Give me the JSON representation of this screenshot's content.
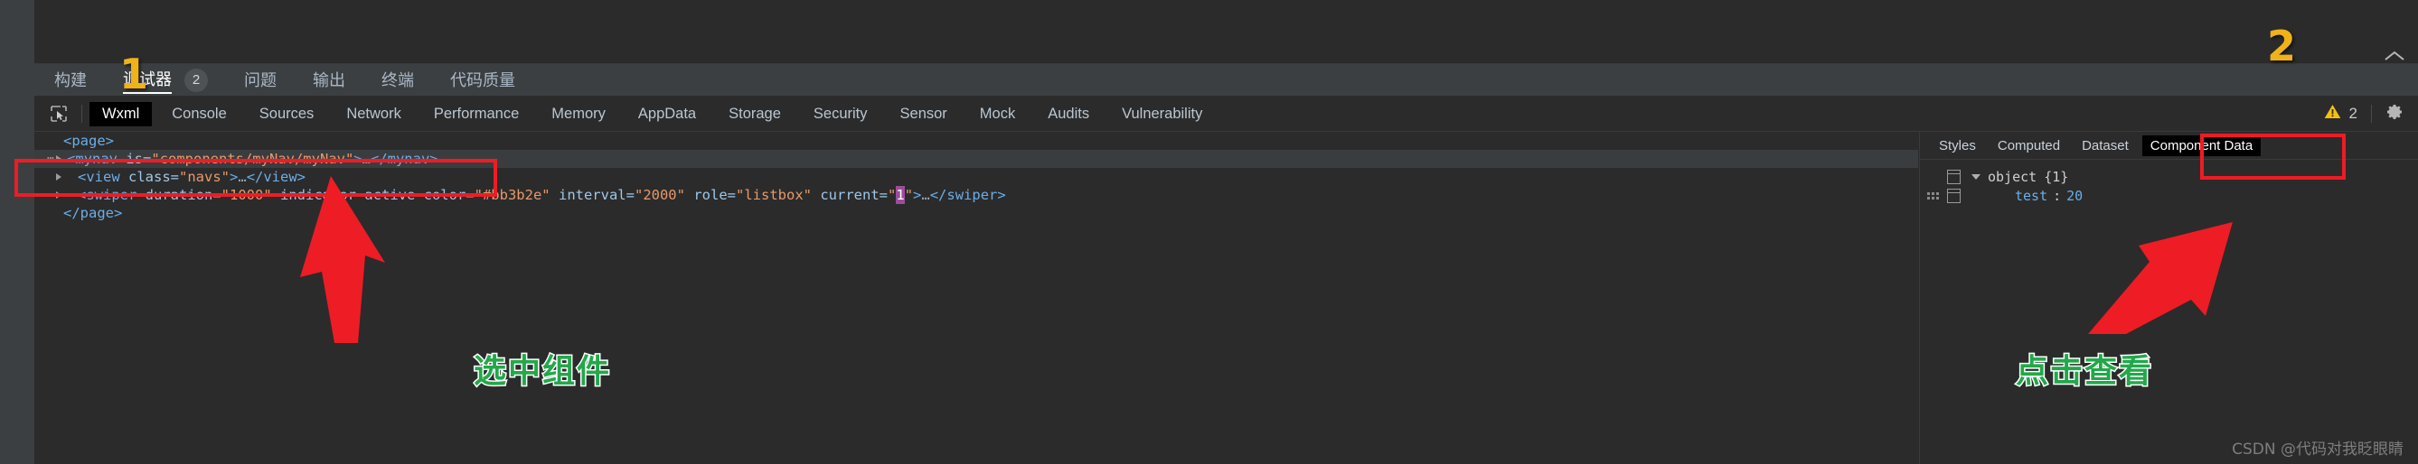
{
  "outer_tabs": [
    {
      "label": "构建",
      "active": false,
      "badge": null
    },
    {
      "label": "调试器",
      "active": true,
      "badge": "2"
    },
    {
      "label": "问题",
      "active": false,
      "badge": null
    },
    {
      "label": "输出",
      "active": false,
      "badge": null
    },
    {
      "label": "终端",
      "active": false,
      "badge": null
    },
    {
      "label": "代码质量",
      "active": false,
      "badge": null
    }
  ],
  "devtools_tabs": [
    {
      "label": "Wxml",
      "active": true
    },
    {
      "label": "Console",
      "active": false
    },
    {
      "label": "Sources",
      "active": false
    },
    {
      "label": "Network",
      "active": false
    },
    {
      "label": "Performance",
      "active": false
    },
    {
      "label": "Memory",
      "active": false
    },
    {
      "label": "AppData",
      "active": false
    },
    {
      "label": "Storage",
      "active": false
    },
    {
      "label": "Security",
      "active": false
    },
    {
      "label": "Sensor",
      "active": false
    },
    {
      "label": "Mock",
      "active": false
    },
    {
      "label": "Audits",
      "active": false
    },
    {
      "label": "Vulnerability",
      "active": false
    }
  ],
  "toolbar": {
    "inspect_icon": "inspect-element-icon",
    "warning_icon": "warning-triangle-icon",
    "warning_count": "2",
    "settings_icon": "gear-icon",
    "collapse_icon": "chevron-up-icon"
  },
  "code": {
    "line_page_open": "<page>",
    "line_mynav": {
      "dots": "⋯",
      "tag_open": "<mynav ",
      "attr": "is=",
      "value": "\"components/myNav/myNav\"",
      "gt": ">",
      "ellipsis": "…",
      "tag_close": "</mynav>"
    },
    "line_view": {
      "tag_open": "<view ",
      "attr": "class=",
      "value": "\"navs\"",
      "gt": ">",
      "ellipsis": "…",
      "tag_close": "</view>"
    },
    "line_swiper": {
      "tag_open": "<swiper ",
      "attr1": "duration=",
      "value1": "\"1000\"",
      "attr2": "indicator-active-color=",
      "value2": "\"#bb3b2e\"",
      "attr3": "interval=",
      "value3": "\"2000\"",
      "attr4": "role=",
      "value4": "\"listbox\"",
      "attr5": "current=",
      "value5_quote_open": "\"",
      "value5_highlight": "1",
      "value5_quote_close": "\"",
      "gt": ">",
      "ellipsis": "…",
      "tag_close": "</swiper>"
    },
    "line_page_close": "</page>"
  },
  "right_panel": {
    "tabs": [
      {
        "label": "Styles",
        "active": false
      },
      {
        "label": "Computed",
        "active": false
      },
      {
        "label": "Dataset",
        "active": false
      },
      {
        "label": "Component Data",
        "active": true
      }
    ],
    "rows": [
      {
        "caret": "▼",
        "name": "object",
        "count": "{1}",
        "key": null,
        "value": null
      },
      {
        "caret": null,
        "name": null,
        "count": null,
        "key": "test",
        "colon": ":",
        "value": "20"
      }
    ]
  },
  "annotations": {
    "marker_1": "1",
    "marker_2": "2",
    "note_left": "选中组件",
    "note_right": "点击查看",
    "colors": {
      "highlight_box": "#ee1c25",
      "marker": "#f0b21a",
      "note": "#22a84a",
      "arrow": "#ee1c25"
    }
  },
  "watermark": "CSDN @代码对我眨眼睛"
}
